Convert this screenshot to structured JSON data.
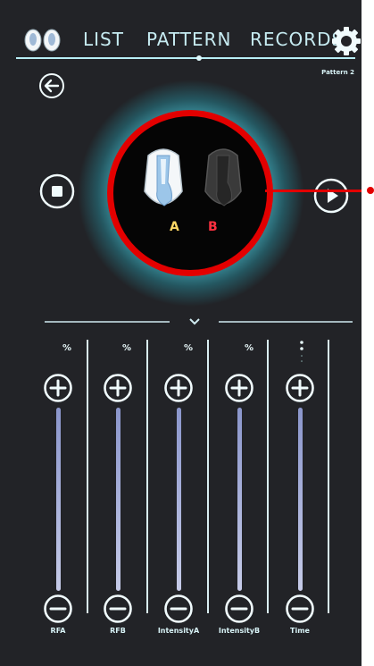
{
  "header": {
    "tabs": [
      {
        "label": "LIST"
      },
      {
        "label": "PATTERN"
      },
      {
        "label": "RECORDS"
      }
    ],
    "pattern_label": "Pattern 2"
  },
  "devices": {
    "a_label": "A",
    "b_label": "B"
  },
  "sliders": [
    {
      "name": "RFA",
      "unit": "%"
    },
    {
      "name": "RFB",
      "unit": "%"
    },
    {
      "name": "IntensityA",
      "unit": "%"
    },
    {
      "name": "IntensityB",
      "unit": "%"
    },
    {
      "name": "Time",
      "unit": ""
    }
  ],
  "colors": {
    "background": "#222327",
    "accent": "#9fe9f3",
    "highlight_ring": "#e30000",
    "label_a": "#ffd966",
    "label_b": "#ff3040"
  },
  "icons": [
    "earbuds-logo-icon",
    "gear-icon",
    "back-arrow-icon",
    "stop-icon",
    "play-icon",
    "chevron-down-icon",
    "plus-icon",
    "minus-icon"
  ]
}
